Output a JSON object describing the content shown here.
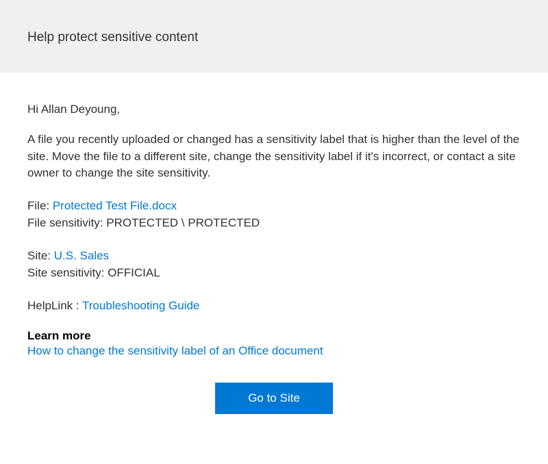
{
  "header": {
    "title": "Help protect sensitive content"
  },
  "greeting": "Hi Allan Deyoung,",
  "message": "A file you recently uploaded or changed has a sensitivity label that is higher than the level of the site. Move the file to a different site, change the sensitivity label if it's incorrect, or contact a site owner to change the site sensitivity.",
  "file": {
    "label": "File: ",
    "name": "Protected Test File.docx",
    "sensitivity_label": "File sensitivity: ",
    "sensitivity_value": "PROTECTED \\ PROTECTED"
  },
  "site": {
    "label": "Site: ",
    "name": "U.S. Sales",
    "sensitivity_label": "Site sensitivity: ",
    "sensitivity_value": "OFFICIAL"
  },
  "helplink": {
    "label": "HelpLink : ",
    "text": "Troubleshooting Guide"
  },
  "learn_more": {
    "title": "Learn more",
    "link_text": "How to change the sensitivity label of an Office document"
  },
  "button": {
    "label": "Go to Site"
  }
}
